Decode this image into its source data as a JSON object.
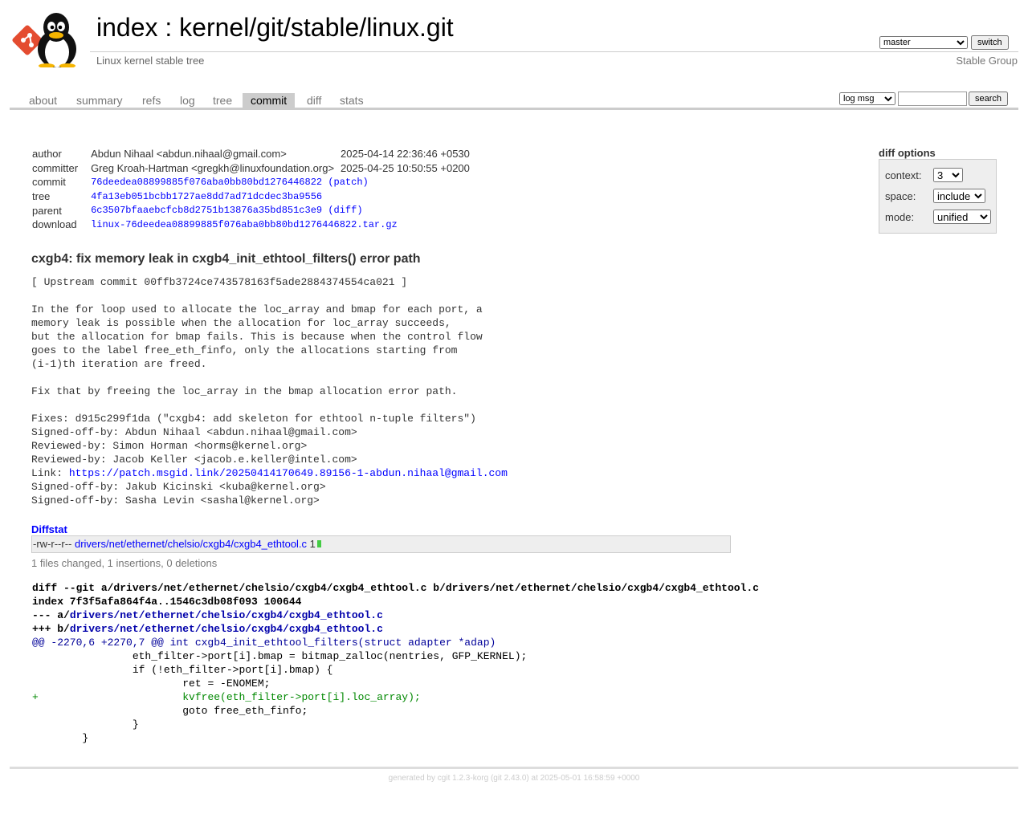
{
  "header": {
    "index_label": "index",
    "title_sep": " : ",
    "repo_path": "kernel/git/stable/linux.git",
    "description": "Linux kernel stable tree",
    "owner": "Stable Group",
    "branch": "master",
    "switch_label": "switch"
  },
  "tabs": [
    "about",
    "summary",
    "refs",
    "log",
    "tree",
    "commit",
    "diff",
    "stats"
  ],
  "active_tab": "commit",
  "search": {
    "type": "log msg",
    "button": "search"
  },
  "commit_info": {
    "author_label": "author",
    "author": "Abdun Nihaal <abdun.nihaal@gmail.com>",
    "author_date": "2025-04-14 22:36:46 +0530",
    "committer_label": "committer",
    "committer": "Greg Kroah-Hartman <gregkh@linuxfoundation.org>",
    "committer_date": "2025-04-25 10:50:55 +0200",
    "commit_label": "commit",
    "commit": "76deedea08899885f076aba0bb80bd1276446822",
    "patch_label": "(patch)",
    "tree_label": "tree",
    "tree": "4fa13eb051bcbb1727ae8dd7ad71dcdec3ba9556",
    "parent_label": "parent",
    "parent": "6c3507bfaaebcfcb8d2751b13876a35bd851c3e9",
    "diff_label": "(diff)",
    "download_label": "download",
    "download": "linux-76deedea08899885f076aba0bb80bd1276446822.tar.gz"
  },
  "diff_options": {
    "title": "diff options",
    "context_label": "context:",
    "context": "3",
    "space_label": "space:",
    "space": "include",
    "mode_label": "mode:",
    "mode": "unified"
  },
  "subject": "cxgb4: fix memory leak in cxgb4_init_ethtool_filters() error path",
  "message_before_link": "[ Upstream commit 00ffb3724ce743578163f5ade2884374554ca021 ]\n\nIn the for loop used to allocate the loc_array and bmap for each port, a\nmemory leak is possible when the allocation for loc_array succeeds,\nbut the allocation for bmap fails. This is because when the control flow\ngoes to the label free_eth_finfo, only the allocations starting from\n(i-1)th iteration are freed.\n\nFix that by freeing the loc_array in the bmap allocation error path.\n\nFixes: d915c299f1da (\"cxgb4: add skeleton for ethtool n-tuple filters\")\nSigned-off-by: Abdun Nihaal <abdun.nihaal@gmail.com>\nReviewed-by: Simon Horman <horms@kernel.org>\nReviewed-by: Jacob Keller <jacob.e.keller@intel.com>\nLink: ",
  "message_link": "https://patch.msgid.link/20250414170649.89156-1-abdun.nihaal@gmail.com",
  "message_after_link": "\nSigned-off-by: Jakub Kicinski <kuba@kernel.org>\nSigned-off-by: Sasha Levin <sashal@kernel.org>",
  "diffstat": {
    "title": "Diffstat",
    "mode": "-rw-r--r--",
    "file": "drivers/net/ethernet/chelsio/cxgb4/cxgb4_ethtool.c",
    "count": "1",
    "summary": "1 files changed, 1 insertions, 0 deletions"
  },
  "diff": {
    "git_line": "diff --git a/drivers/net/ethernet/chelsio/cxgb4/cxgb4_ethtool.c b/drivers/net/ethernet/chelsio/cxgb4/cxgb4_ethtool.c",
    "index_line": "index 7f3f5afa864f4a..1546c3db08f093 100644",
    "old_prefix": "--- a/",
    "new_prefix": "+++ b/",
    "file": "drivers/net/ethernet/chelsio/cxgb4/cxgb4_ethtool.c",
    "hunk": "@@ -2270,6 +2270,7 @@ int cxgb4_init_ethtool_filters(struct adapter *adap)",
    "lines": [
      {
        "t": "ctx",
        "s": " \t\teth_filter->port[i].bmap = bitmap_zalloc(nentries, GFP_KERNEL);"
      },
      {
        "t": "ctx",
        "s": " \t\tif (!eth_filter->port[i].bmap) {"
      },
      {
        "t": "ctx",
        "s": " \t\t\tret = -ENOMEM;"
      },
      {
        "t": "add",
        "s": "+\t\t\tkvfree(eth_filter->port[i].loc_array);"
      },
      {
        "t": "ctx",
        "s": " \t\t\tgoto free_eth_finfo;"
      },
      {
        "t": "ctx",
        "s": " \t\t}"
      },
      {
        "t": "ctx",
        "s": " \t}"
      }
    ]
  },
  "footer": {
    "prefix": "generated by ",
    "cgit": "cgit 1.2.3-korg",
    "git": "(git 2.43.0)",
    "at": " at 2025-05-01 16:58:59 +0000"
  }
}
